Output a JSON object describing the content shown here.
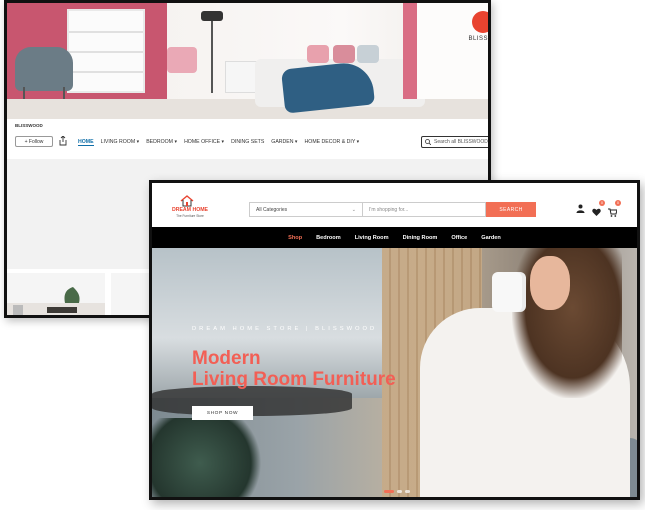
{
  "back_store": {
    "brand": "BLISSWOOD",
    "logo_text": "BLISS",
    "follow_label": "+ Follow",
    "nav": [
      "HOME",
      "LIVING ROOM ▾",
      "BEDROOM ▾",
      "HOME OFFICE ▾",
      "DINING SETS",
      "GARDEN ▾",
      "HOME DECOR & DIY ▾"
    ],
    "search_placeholder": "Search all BLISSWOOD"
  },
  "front_store": {
    "logo_name": "DREAM HOME",
    "logo_tagline": "The Furniture Store",
    "category_select": "All Categories",
    "search_placeholder": "I'm shopping for...",
    "search_button": "SEARCH",
    "wishlist_count": "0",
    "cart_count": "0",
    "nav": [
      "Shop",
      "Bedroom",
      "Living Room",
      "Dining Room",
      "Office",
      "Garden"
    ],
    "hero": {
      "tagline": "DREAM HOME STORE | BLISSWOOD",
      "title_line1": "Modern",
      "title_line2": "Living Room Furniture",
      "button": "SHOP NOW"
    }
  },
  "colors": {
    "accent": "#f26f55",
    "title": "#f25f55",
    "nav_bg": "#000000",
    "link": "#0f6ea8"
  },
  "icons": [
    "share-icon",
    "search-icon",
    "user-icon",
    "heart-icon",
    "cart-icon",
    "house-logo-icon",
    "chevron-down-icon"
  ]
}
